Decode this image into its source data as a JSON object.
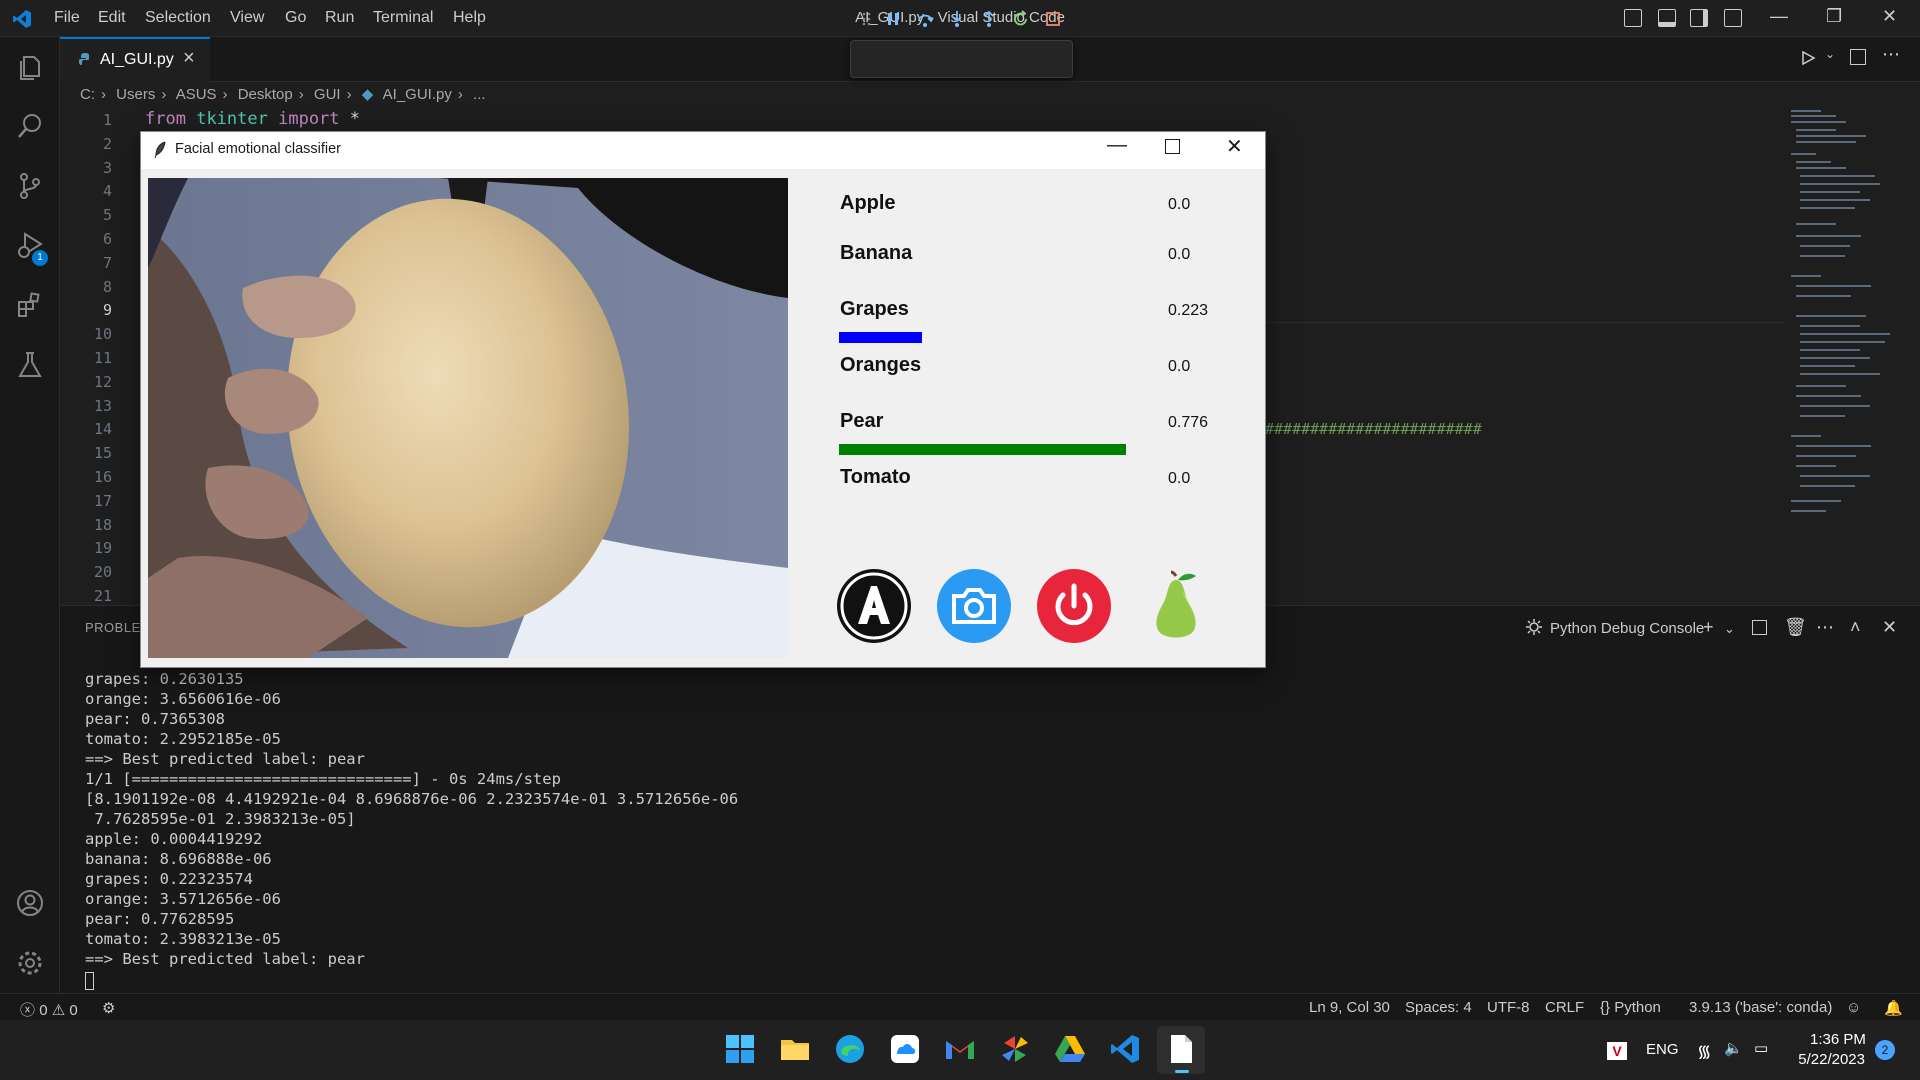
{
  "titlebar": {
    "menu": [
      "File",
      "Edit",
      "Selection",
      "View",
      "Go",
      "Run",
      "Terminal",
      "Help"
    ],
    "title": "AI_GUI.py - Visual Studio Code"
  },
  "activity_bar": {
    "items": [
      "explorer-icon",
      "search-icon",
      "source-control-icon",
      "run-debug-icon",
      "extensions-icon",
      "testing-icon"
    ],
    "debug_badge": "1",
    "bottom": [
      "account-icon",
      "settings-gear-icon"
    ]
  },
  "tabs": [
    {
      "label": "AI_GUI.py",
      "active": true
    }
  ],
  "breadcrumb": [
    "C:",
    "Users",
    "ASUS",
    "Desktop",
    "GUI",
    "AI_GUI.py",
    "..."
  ],
  "editor": {
    "line_numbers": [
      "1",
      "2",
      "3",
      "4",
      "5",
      "6",
      "7",
      "8",
      "9",
      "10",
      "11",
      "12",
      "13",
      "14",
      "15",
      "16",
      "17",
      "18",
      "19",
      "20",
      "21"
    ],
    "active_line": "9",
    "code_line1": {
      "kw1": "from",
      "module": "tkinter",
      "kw2": "import",
      "star": "*"
    },
    "hash_text": "########################"
  },
  "panel": {
    "tab_label": "PROBLEM",
    "console_title": "Python Debug Console",
    "lines": [
      "grapes: 0.2630135",
      "orange: 3.6560616e-06",
      "pear: 0.7365308",
      "tomato: 2.2952185e-05",
      "==> Best predicted label: pear",
      "1/1 [==============================] - 0s 24ms/step",
      "[8.1901192e-08 4.4192921e-04 8.6968876e-06 2.2323574e-01 3.5712656e-06",
      " 7.7628595e-01 2.3983213e-05]",
      "apple: 0.0004419292",
      "banana: 8.696888e-06",
      "grapes: 0.22323574",
      "orange: 3.5712656e-06",
      "pear: 0.77628595",
      "tomato: 2.3983213e-05",
      "==> Best predicted label: pear"
    ]
  },
  "statusbar": {
    "errors": "0",
    "warnings": "0",
    "position": "Ln 9, Col 30",
    "spaces": "Spaces: 4",
    "encoding": "UTF-8",
    "eol": "CRLF",
    "language": "Python",
    "interpreter": "3.9.13 ('base': conda)"
  },
  "taskbar": {
    "apps": [
      "windows-start-icon",
      "file-explorer-icon",
      "edge-icon",
      "cloud-app-icon",
      "gmail-icon",
      "photos-icon",
      "google-drive-icon",
      "vscode-icon",
      "notepad-icon"
    ],
    "lang": "ENG",
    "time": "1:36 PM",
    "date": "5/22/2023",
    "notifications": "2"
  },
  "tk_window": {
    "title": "Facial emotional classifier",
    "fruits": [
      {
        "name": "Apple",
        "value": "0.0",
        "prob": 0.0,
        "color": "#0000ff"
      },
      {
        "name": "Banana",
        "value": "0.0",
        "prob": 0.0,
        "color": "#0000ff"
      },
      {
        "name": "Grapes",
        "value": "0.223",
        "prob": 0.223,
        "color": "#0000ff"
      },
      {
        "name": "Oranges",
        "value": "0.0",
        "prob": 0.0,
        "color": "#0000ff"
      },
      {
        "name": "Pear",
        "value": "0.776",
        "prob": 0.776,
        "color": "#008000"
      },
      {
        "name": "Tomato",
        "value": "0.0",
        "prob": 0.0,
        "color": "#0000ff"
      }
    ],
    "buttons": [
      "letter-a-icon",
      "camera-icon",
      "power-icon",
      "pear-icon"
    ]
  },
  "colors": {
    "accent": "#0078d4",
    "power_red": "#e8263b",
    "camera_blue": "#2a9af2",
    "bar_blue": "#0000ff",
    "bar_green": "#008000"
  }
}
